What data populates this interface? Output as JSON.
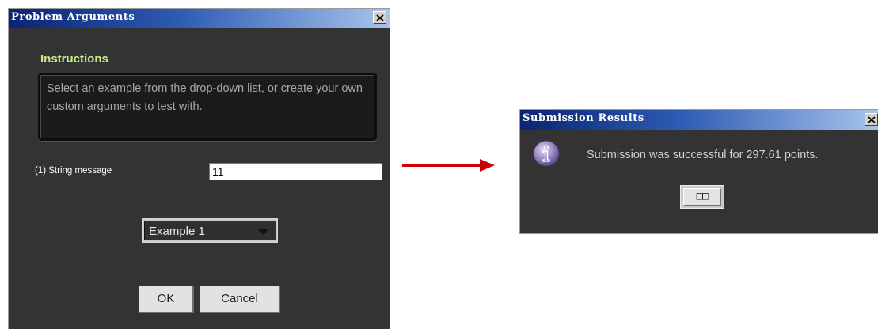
{
  "problem_window": {
    "title": "Problem Arguments",
    "instructions_heading": "Instructions",
    "instructions_text": "Select an example from the drop-down list, or create your own custom arguments to test with.",
    "argument_label": "(1) String message",
    "argument_value": "11",
    "example_selected": "Example 1",
    "ok_label": "OK",
    "cancel_label": "Cancel"
  },
  "results_window": {
    "title": "Submission Results",
    "message": "Submission was successful for 297.61 points.",
    "button_label": "□□",
    "icon": "info-icon"
  },
  "colors": {
    "window_bg": "#333333",
    "title_gradient_start": "#0a2472",
    "title_gradient_end": "#a8c4ec",
    "heading_green": "#c9ee8f",
    "arrow_red": "#cc0000"
  }
}
